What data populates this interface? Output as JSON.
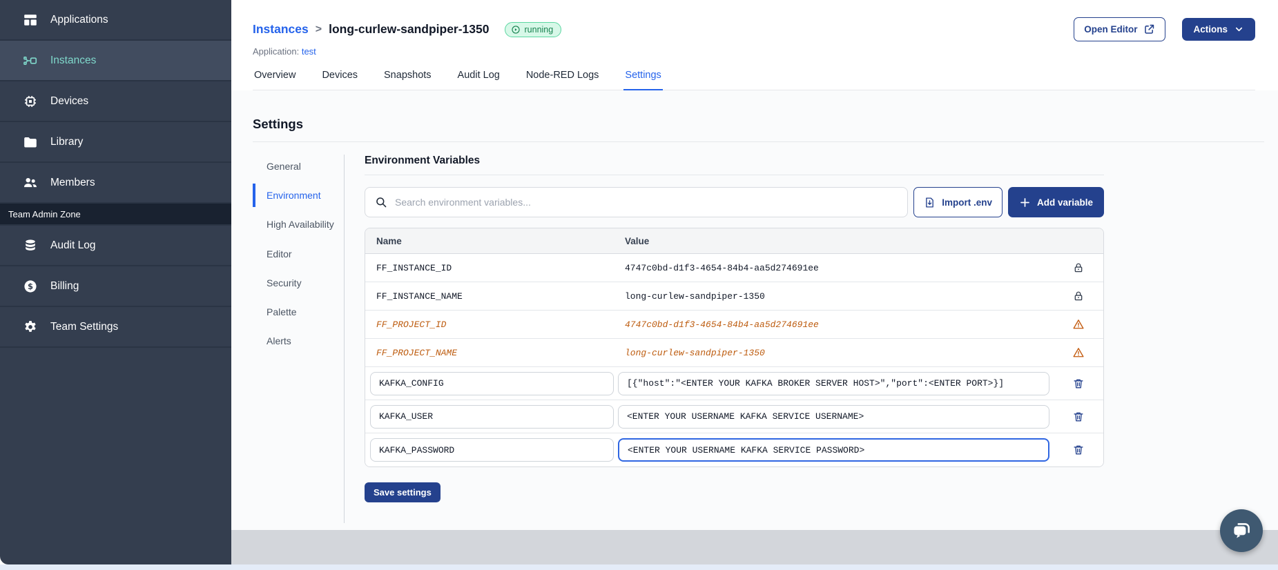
{
  "sidebar": {
    "items": [
      {
        "label": "Applications",
        "icon": "applications-icon",
        "active": false
      },
      {
        "label": "Instances",
        "icon": "instances-icon",
        "active": true
      },
      {
        "label": "Devices",
        "icon": "devices-icon",
        "active": false
      },
      {
        "label": "Library",
        "icon": "library-icon",
        "active": false
      },
      {
        "label": "Members",
        "icon": "members-icon",
        "active": false
      }
    ],
    "section_label": "Team Admin Zone",
    "admin_items": [
      {
        "label": "Audit Log",
        "icon": "audit-log-icon"
      },
      {
        "label": "Billing",
        "icon": "billing-icon"
      },
      {
        "label": "Team Settings",
        "icon": "team-settings-icon"
      }
    ]
  },
  "header": {
    "breadcrumb_root": "Instances",
    "breadcrumb_separator": ">",
    "instance_name": "long-curlew-sandpiper-1350",
    "status_label": "running",
    "application_label": "Application:",
    "application_link": "test",
    "open_editor_label": "Open Editor",
    "actions_label": "Actions"
  },
  "tabs": [
    {
      "label": "Overview",
      "active": false
    },
    {
      "label": "Devices",
      "active": false
    },
    {
      "label": "Snapshots",
      "active": false
    },
    {
      "label": "Audit Log",
      "active": false
    },
    {
      "label": "Node-RED Logs",
      "active": false
    },
    {
      "label": "Settings",
      "active": true
    }
  ],
  "settings": {
    "title": "Settings",
    "nav": [
      {
        "label": "General",
        "active": false
      },
      {
        "label": "Environment",
        "active": true
      },
      {
        "label": "High Availability",
        "active": false
      },
      {
        "label": "Editor",
        "active": false
      },
      {
        "label": "Security",
        "active": false
      },
      {
        "label": "Palette",
        "active": false
      },
      {
        "label": "Alerts",
        "active": false
      }
    ],
    "panel": {
      "title": "Environment Variables",
      "search_placeholder": "Search environment variables...",
      "import_button_label": "Import .env",
      "add_button_label": "Add variable",
      "columns": [
        "Name",
        "Value"
      ],
      "rows": [
        {
          "name": "FF_INSTANCE_ID",
          "value": "4747c0bd-d1f3-4654-84b4-aa5d274691ee",
          "kind": "locked"
        },
        {
          "name": "FF_INSTANCE_NAME",
          "value": "long-curlew-sandpiper-1350",
          "kind": "locked"
        },
        {
          "name": "FF_PROJECT_ID",
          "value": "4747c0bd-d1f3-4654-84b4-aa5d274691ee",
          "kind": "deprecated"
        },
        {
          "name": "FF_PROJECT_NAME",
          "value": "long-curlew-sandpiper-1350",
          "kind": "deprecated"
        },
        {
          "name": "KAFKA_CONFIG",
          "value": "[{\"host\":\"<ENTER YOUR KAFKA BROKER SERVER HOST>\",\"port\":<ENTER PORT>}]",
          "kind": "editable",
          "focused": false
        },
        {
          "name": "KAFKA_USER",
          "value": "<ENTER YOUR USERNAME KAFKA SERVICE USERNAME>",
          "kind": "editable",
          "focused": false
        },
        {
          "name": "KAFKA_PASSWORD",
          "value": "<ENTER YOUR USERNAME KAFKA SERVICE PASSWORD>",
          "kind": "editable",
          "focused": true
        }
      ],
      "save_button_label": "Save settings"
    }
  },
  "colors": {
    "sidebar_bg": "#343E4F",
    "sidebar_active_bg": "#414C5F",
    "teal_accent": "#7FD8CB",
    "navy_primary": "#24418D",
    "link_blue": "#2563eb",
    "deprecated_orange": "#BD5B0E",
    "status_green_bg": "#D7F8E8",
    "status_green_border": "#5BD6A1",
    "status_green_text": "#17824F",
    "focus_blue": "#2F66E2",
    "footer_band": "#D3D6DB"
  }
}
